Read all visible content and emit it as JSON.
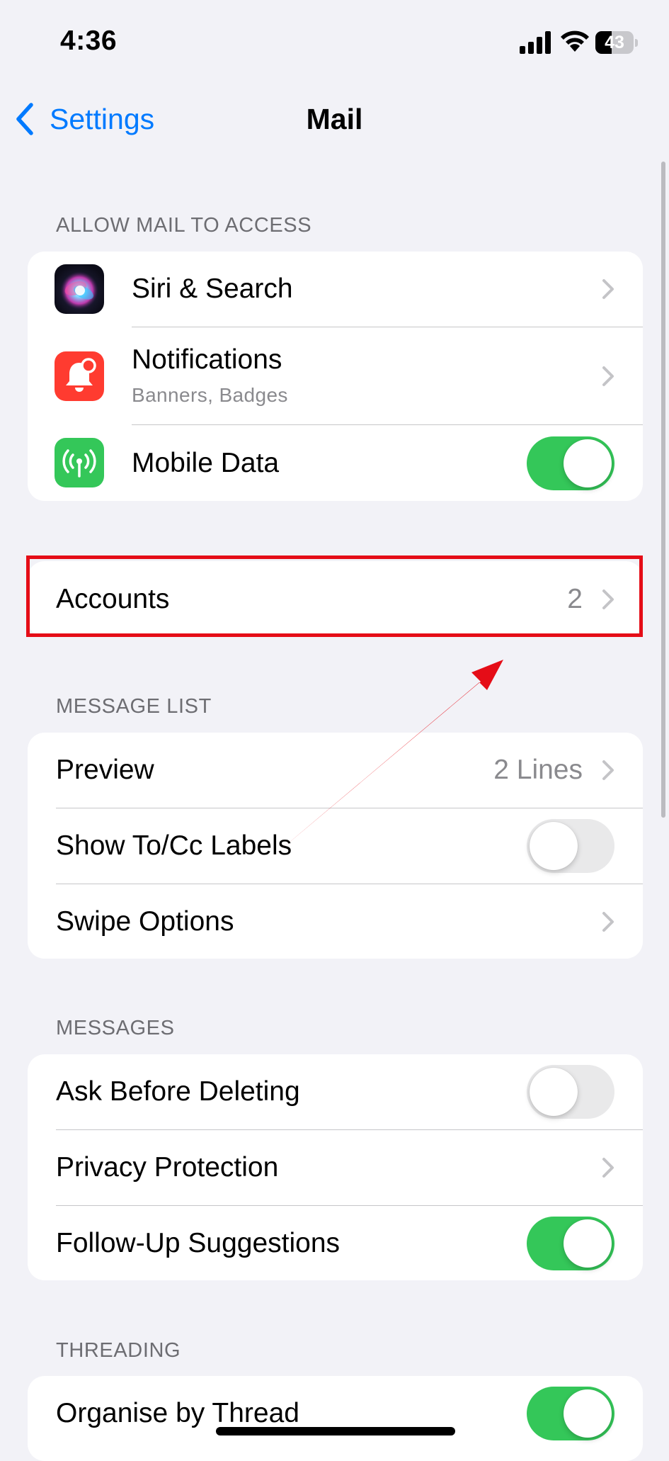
{
  "status_bar": {
    "time": "4:36",
    "battery_percent": "43",
    "battery_level": 0.43,
    "signal_icon": "signal-bars-icon",
    "wifi_icon": "wifi-icon"
  },
  "nav": {
    "back_label": "Settings",
    "title": "Mail"
  },
  "sections": {
    "allow_access": {
      "header": "ALLOW MAIL TO ACCESS",
      "siri": {
        "label": "Siri & Search",
        "icon": "siri-icon"
      },
      "notifications": {
        "label": "Notifications",
        "subtitle": "Banners, Badges",
        "icon": "notifications-bell-icon"
      },
      "mobile_data": {
        "label": "Mobile Data",
        "icon": "antenna-icon",
        "enabled": true
      }
    },
    "accounts": {
      "label": "Accounts",
      "value": "2"
    },
    "message_list": {
      "header": "MESSAGE LIST",
      "preview": {
        "label": "Preview",
        "value": "2 Lines"
      },
      "show_to_cc": {
        "label": "Show To/Cc Labels",
        "enabled": false
      },
      "swipe_options": {
        "label": "Swipe Options"
      }
    },
    "messages": {
      "header": "MESSAGES",
      "ask_before_deleting": {
        "label": "Ask Before Deleting",
        "enabled": false
      },
      "privacy_protection": {
        "label": "Privacy Protection"
      },
      "follow_up": {
        "label": "Follow-Up Suggestions",
        "enabled": true
      }
    },
    "threading": {
      "header": "THREADING",
      "organise_by_thread": {
        "label": "Organise by Thread",
        "enabled": true
      }
    }
  },
  "colors": {
    "accent": "#007aff",
    "toggle_on": "#34c759",
    "annotation": "#e50d17"
  }
}
